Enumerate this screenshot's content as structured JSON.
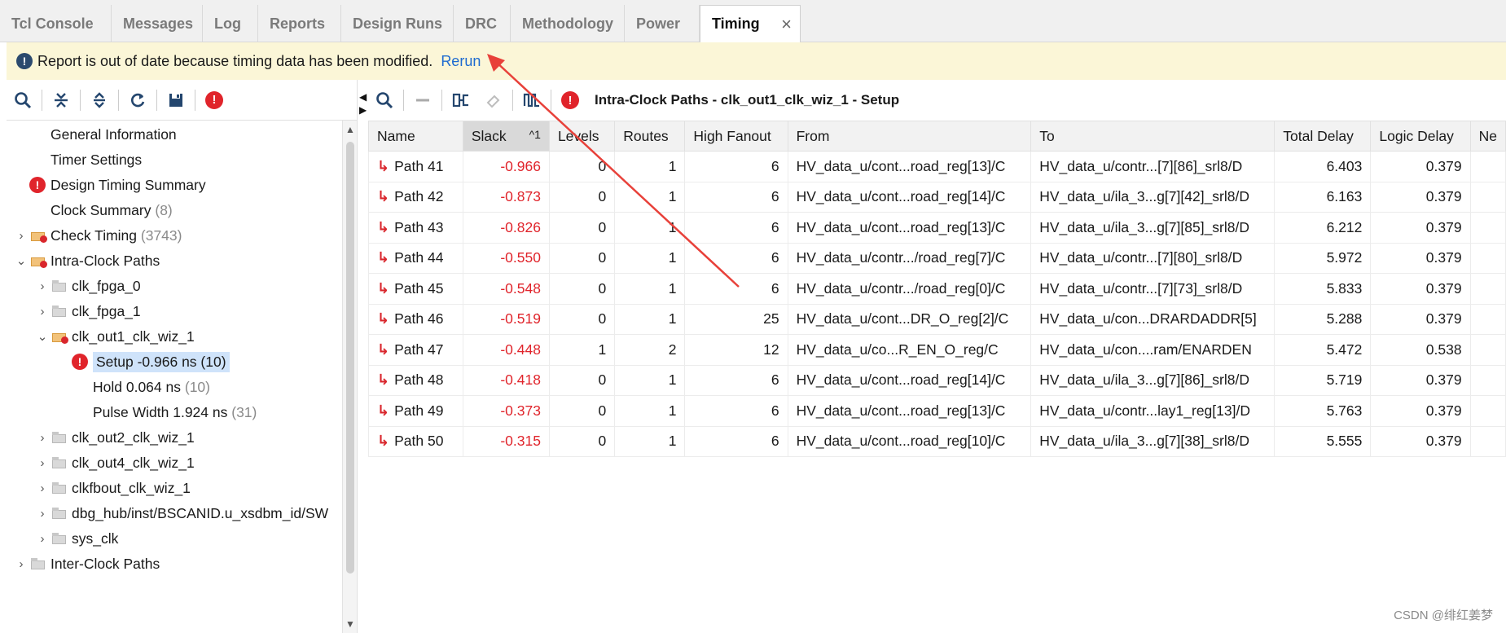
{
  "tabs": [
    {
      "label": "Tcl Console",
      "active": false
    },
    {
      "label": "Messages",
      "active": false
    },
    {
      "label": "Log",
      "active": false
    },
    {
      "label": "Reports",
      "active": false
    },
    {
      "label": "Design Runs",
      "active": false
    },
    {
      "label": "DRC",
      "active": false
    },
    {
      "label": "Methodology",
      "active": false
    },
    {
      "label": "Power",
      "active": false
    },
    {
      "label": "Timing",
      "active": true
    }
  ],
  "tab_close": "×",
  "banner": {
    "message": "Report is out of date because timing data has been modified.",
    "link": "Rerun"
  },
  "right_title": "Intra-Clock Paths - clk_out1_clk_wiz_1 - Setup",
  "tree": [
    {
      "label": "General Information",
      "count": ""
    },
    {
      "label": "Timer Settings",
      "count": ""
    },
    {
      "label": "Design Timing Summary",
      "count": ""
    },
    {
      "label": "Clock Summary",
      "count": "(8)"
    },
    {
      "label": "Check Timing",
      "count": "(3743)"
    },
    {
      "label": "Intra-Clock Paths",
      "count": ""
    },
    {
      "label": "clk_fpga_0",
      "count": ""
    },
    {
      "label": "clk_fpga_1",
      "count": ""
    },
    {
      "label": "clk_out1_clk_wiz_1",
      "count": ""
    },
    {
      "label": "Setup -0.966 ns (10)",
      "count": ""
    },
    {
      "label": "Hold 0.064 ns",
      "count": "(10)"
    },
    {
      "label": "Pulse Width 1.924 ns",
      "count": "(31)"
    },
    {
      "label": "clk_out2_clk_wiz_1",
      "count": ""
    },
    {
      "label": "clk_out4_clk_wiz_1",
      "count": ""
    },
    {
      "label": "clkfbout_clk_wiz_1",
      "count": ""
    },
    {
      "label": "dbg_hub/inst/BSCANID.u_xsdbm_id/SW",
      "count": ""
    },
    {
      "label": "sys_clk",
      "count": ""
    },
    {
      "label": "Inter-Clock Paths",
      "count": ""
    }
  ],
  "table": {
    "columns": [
      "Name",
      "Slack",
      "Levels",
      "Routes",
      "High Fanout",
      "From",
      "To",
      "Total Delay",
      "Logic Delay",
      "Ne"
    ],
    "sort_marker": "^1",
    "rows": [
      {
        "name": "Path 41",
        "slack": "-0.966",
        "levels": "0",
        "routes": "1",
        "fanout": "6",
        "from": "HV_data_u/cont...road_reg[13]/C",
        "to": "HV_data_u/contr...[7][86]_srl8/D",
        "total": "6.403",
        "logic": "0.379"
      },
      {
        "name": "Path 42",
        "slack": "-0.873",
        "levels": "0",
        "routes": "1",
        "fanout": "6",
        "from": "HV_data_u/cont...road_reg[14]/C",
        "to": "HV_data_u/ila_3...g[7][42]_srl8/D",
        "total": "6.163",
        "logic": "0.379"
      },
      {
        "name": "Path 43",
        "slack": "-0.826",
        "levels": "0",
        "routes": "1",
        "fanout": "6",
        "from": "HV_data_u/cont...road_reg[13]/C",
        "to": "HV_data_u/ila_3...g[7][85]_srl8/D",
        "total": "6.212",
        "logic": "0.379"
      },
      {
        "name": "Path 44",
        "slack": "-0.550",
        "levels": "0",
        "routes": "1",
        "fanout": "6",
        "from": "HV_data_u/contr.../road_reg[7]/C",
        "to": "HV_data_u/contr...[7][80]_srl8/D",
        "total": "5.972",
        "logic": "0.379"
      },
      {
        "name": "Path 45",
        "slack": "-0.548",
        "levels": "0",
        "routes": "1",
        "fanout": "6",
        "from": "HV_data_u/contr.../road_reg[0]/C",
        "to": "HV_data_u/contr...[7][73]_srl8/D",
        "total": "5.833",
        "logic": "0.379"
      },
      {
        "name": "Path 46",
        "slack": "-0.519",
        "levels": "0",
        "routes": "1",
        "fanout": "25",
        "from": "HV_data_u/cont...DR_O_reg[2]/C",
        "to": "HV_data_u/con...DRARDADDR[5]",
        "total": "5.288",
        "logic": "0.379"
      },
      {
        "name": "Path 47",
        "slack": "-0.448",
        "levels": "1",
        "routes": "2",
        "fanout": "12",
        "from": "HV_data_u/co...R_EN_O_reg/C",
        "to": "HV_data_u/con....ram/ENARDEN",
        "total": "5.472",
        "logic": "0.538"
      },
      {
        "name": "Path 48",
        "slack": "-0.418",
        "levels": "0",
        "routes": "1",
        "fanout": "6",
        "from": "HV_data_u/cont...road_reg[14]/C",
        "to": "HV_data_u/ila_3...g[7][86]_srl8/D",
        "total": "5.719",
        "logic": "0.379"
      },
      {
        "name": "Path 49",
        "slack": "-0.373",
        "levels": "0",
        "routes": "1",
        "fanout": "6",
        "from": "HV_data_u/cont...road_reg[13]/C",
        "to": "HV_data_u/contr...lay1_reg[13]/D",
        "total": "5.763",
        "logic": "0.379"
      },
      {
        "name": "Path 50",
        "slack": "-0.315",
        "levels": "0",
        "routes": "1",
        "fanout": "6",
        "from": "HV_data_u/cont...road_reg[10]/C",
        "to": "HV_data_u/ila_3...g[7][38]_srl8/D",
        "total": "5.555",
        "logic": "0.379"
      }
    ]
  },
  "watermark": "CSDN @绯红姜梦",
  "colors": {
    "error": "#e0242b",
    "link": "#1e6bd0",
    "banner": "#fbf6d7",
    "annotation_arrow": "#e8413a"
  }
}
